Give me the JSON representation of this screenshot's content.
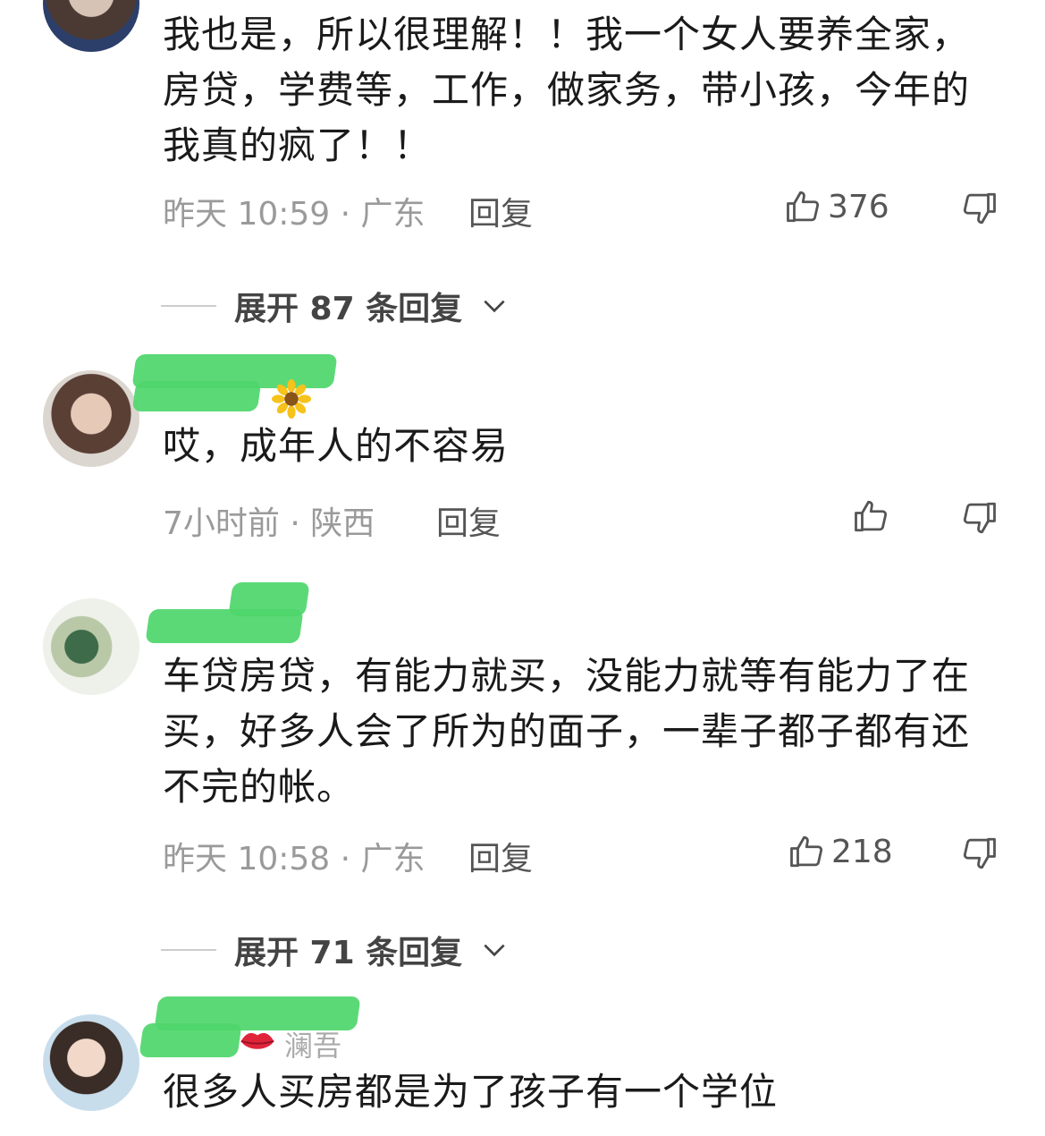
{
  "comments": [
    {
      "text": "我也是，所以很理解！！我一个女人要养全家，房贷，学费等，工作，做家务，带小孩，今年的我真的疯了！！",
      "time_location": "昨天 10:59 · 广东",
      "reply_label": "回复",
      "like_count": "376",
      "expand_label": "展开 87 条回复"
    },
    {
      "text": "哎，成年人的不容易",
      "time_location": "7小时前 · 陕西",
      "reply_label": "回复",
      "like_count": ""
    },
    {
      "text": "车贷房贷，有能力就买，没能力就等有能力了在买，好多人会了所为的面子，一辈子都子都有还不完的帐。",
      "time_location": "昨天 10:58 · 广东",
      "reply_label": "回复",
      "like_count": "218",
      "expand_label": "展开 71 条回复"
    },
    {
      "username": "澜吾",
      "text": "很多人买房都是为了孩子有一个学位"
    }
  ],
  "icons": {
    "like": "thumbs-up-icon",
    "dislike": "thumbs-down-icon",
    "expand": "chevron-down-icon",
    "flower": "sunflower-emoji-icon",
    "lips": "lips-emoji-icon"
  },
  "colors": {
    "text": "#1a1a1a",
    "meta": "#9a9a9a",
    "scribble": "#4ed66b"
  }
}
